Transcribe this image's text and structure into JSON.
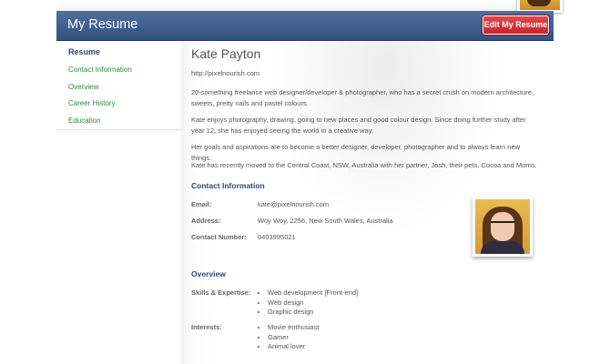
{
  "header": {
    "title": "My Resume",
    "edit_button": "Edit My Resume"
  },
  "sidebar": {
    "heading": "Resume",
    "items": [
      {
        "label": "Contact Information"
      },
      {
        "label": "Overview"
      },
      {
        "label": "Career History"
      },
      {
        "label": "Education"
      }
    ]
  },
  "profile": {
    "name": "Kate Payton",
    "url": "http://pixelnourish.com",
    "paragraphs": [
      "20-something freelance web designer/developer & photographer, who has a secret crush on modern architecture, sweets, pretty nails and pastel colours.",
      "Kate enjoys photography, drawing, going to new places and good colour design. Since doing further study after year 12, she has enjoyed seeing the world in a creative way.",
      "Her goals and aspirations are to become a better designer, developer, photographer and to always learn new things.",
      "Kate has recently moved to the Central Coast, NSW, Australia with her partner, Josh, their pets, Cocoa and Morris."
    ]
  },
  "contact": {
    "title": "Contact Information",
    "email_label": "Email:",
    "email_value": "kate@pixelnourish.com",
    "address_label": "Address:",
    "address_value": "Woy Woy, 2256, New South Wales, Australia",
    "phone_label": "Contact Number:",
    "phone_value": "0403995021"
  },
  "overview": {
    "title": "Overview",
    "skills_label": "Skills & Expertise:",
    "skills": [
      "Web development [Front-end]",
      "Web design",
      "Graphic design"
    ],
    "interests_label": "Interests:",
    "interests": [
      "Movie enthusiast",
      "Gamer",
      "Animal lover"
    ]
  },
  "colors": {
    "header": "#3f5f8f",
    "button": "#d6323a",
    "link": "#2e8a3a",
    "heading": "#2b4a7a"
  }
}
